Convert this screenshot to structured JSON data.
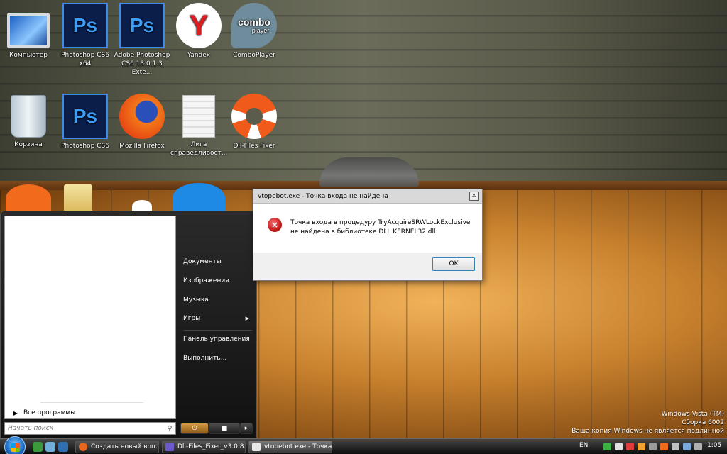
{
  "desktop": {
    "icons": [
      {
        "label": "Компьютер"
      },
      {
        "label": "Photoshop CS6 x64",
        "glyph": "Ps"
      },
      {
        "label": "Adobe Photoshop CS6 13.0.1.3 Exte...",
        "glyph": "Ps"
      },
      {
        "label": "Yandex",
        "glyph": "Y"
      },
      {
        "label": "ComboPlayer",
        "glyph_top": "combo",
        "glyph_bottom": "player"
      },
      {
        "label": "Корзина"
      },
      {
        "label": "Photoshop CS6",
        "glyph": "Ps"
      },
      {
        "label": "Mozilla Firefox"
      },
      {
        "label": "Лига справедливост..."
      },
      {
        "label": "Dll-Files Fixer"
      }
    ]
  },
  "start_menu": {
    "all_programs": "Все программы",
    "search_placeholder": "Начать поиск",
    "right_items": [
      {
        "label": "Документы"
      },
      {
        "label": "Изображения"
      },
      {
        "label": "Музыка"
      },
      {
        "label": "Игры"
      },
      {
        "label": "Панель управления"
      },
      {
        "label": "Выполнить..."
      }
    ]
  },
  "dialog": {
    "title": "vtopebot.exe - Точка входа не найдена",
    "message": "Точка входа в процедуру TryAcquireSRWLockExclusive не найдена в библиотеке DLL KERNEL32.dll.",
    "ok_label": "OK",
    "close_glyph": "x"
  },
  "watermark": {
    "line1": "Windows Vista (TM)",
    "line2": "Сборка 6002",
    "line3": "Ваша копия Windows не является подлинной"
  },
  "taskbar": {
    "tasks": [
      {
        "label": "Создать новый воп..."
      },
      {
        "label": "Dll-Files_Fixer_v3.0.8..."
      },
      {
        "label": "vtopebot.exe - Точка..."
      }
    ],
    "language": "EN",
    "clock": "1:05"
  },
  "colors": {
    "accent": "#3a8ce8",
    "error": "#c51b1b",
    "taskbar": "#1a1a1a"
  }
}
